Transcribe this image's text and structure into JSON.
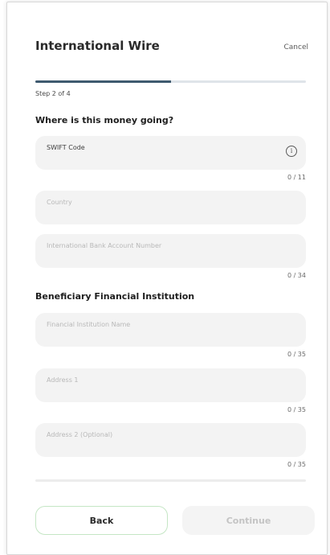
{
  "header": {
    "title": "International Wire",
    "cancel_label": "Cancel"
  },
  "progress": {
    "step_text": "Step 2 of 4",
    "current_step": 2,
    "total_steps": 4
  },
  "section_destination": {
    "title": "Where is this money going?",
    "fields": {
      "swift": {
        "label": "SWIFT Code",
        "counter": "0 / 11"
      },
      "country": {
        "placeholder": "Country"
      },
      "iban": {
        "placeholder": "International Bank Account Number",
        "counter": "0 / 34"
      }
    }
  },
  "section_institution": {
    "title": "Beneficiary Financial Institution",
    "fields": {
      "name": {
        "placeholder": "Financial Institution Name",
        "counter": "0 / 35"
      },
      "address1": {
        "placeholder": "Address 1",
        "counter": "0 / 35"
      },
      "address2": {
        "placeholder": "Address 2 (Optional)",
        "counter": "0 / 35"
      }
    }
  },
  "footer": {
    "back_label": "Back",
    "continue_label": "Continue"
  },
  "colors": {
    "progress_fill": "#3e5a6f",
    "progress_track": "#dfe4e9",
    "back_border": "#c5e6c5",
    "field_bg": "#f3f3f3"
  },
  "icons": {
    "swift_info": "info-icon"
  }
}
